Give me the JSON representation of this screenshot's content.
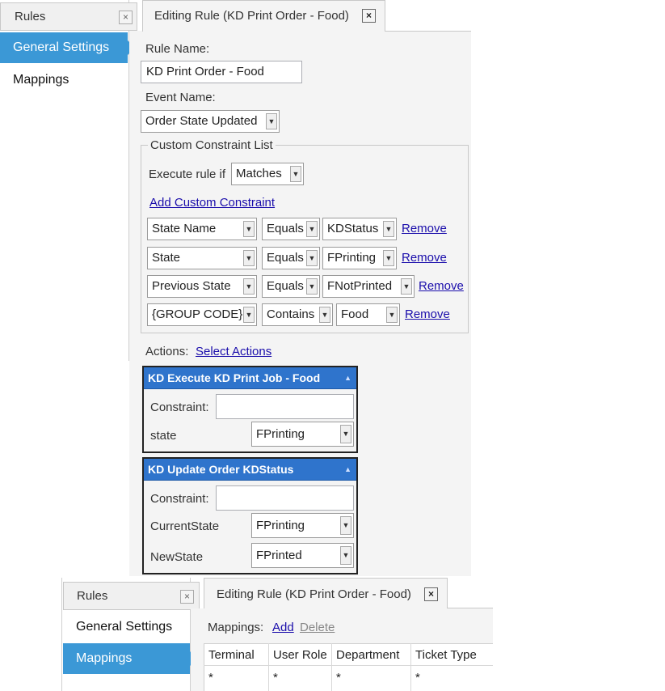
{
  "top": {
    "rules_tab": "Rules",
    "rules_close": "×",
    "editing_tab": "Editing Rule (KD Print Order - Food)",
    "editing_close": "×",
    "nav": {
      "general": "General Settings",
      "mappings": "Mappings"
    },
    "rule_name_label": "Rule Name:",
    "rule_name_value": "KD Print Order - Food",
    "event_name_label": "Event Name:",
    "event_name_value": "Order State Updated",
    "constraints": {
      "legend": "Custom Constraint List",
      "execute_label": "Execute rule if",
      "execute_value": "Matches",
      "add_link": "Add Custom Constraint",
      "remove_label": "Remove",
      "rows": [
        {
          "field": "State Name",
          "op": "Equals",
          "value": "KDStatus"
        },
        {
          "field": "State",
          "op": "Equals",
          "value": "FPrinting"
        },
        {
          "field": "Previous State",
          "op": "Equals",
          "value": "FNotPrinted"
        },
        {
          "field": "{GROUP CODE}",
          "op": "Contains",
          "value": "Food"
        }
      ]
    },
    "actions_label": "Actions:",
    "select_actions": "Select Actions",
    "actions": [
      {
        "title": "KD Execute KD Print Job - Food",
        "constraint_label": "Constraint:",
        "constraint_value": "",
        "param1_label": "state",
        "param1_value": "FPrinting"
      },
      {
        "title": "KD Update Order KDStatus",
        "constraint_label": "Constraint:",
        "constraint_value": "",
        "param1_label": "CurrentState",
        "param1_value": "FPrinting",
        "param2_label": "NewState",
        "param2_value": "FPrinted"
      }
    ]
  },
  "bottom": {
    "rules_tab": "Rules",
    "rules_close": "×",
    "editing_tab": "Editing Rule (KD Print Order - Food)",
    "editing_close": "×",
    "nav": {
      "general": "General Settings",
      "mappings": "Mappings"
    },
    "mappings_label": "Mappings:",
    "add_link": "Add",
    "delete_link": "Delete",
    "columns": [
      "Terminal",
      "User Role",
      "Department",
      "Ticket Type"
    ],
    "row": [
      "*",
      "*",
      "*",
      "*"
    ]
  },
  "colors": {
    "accent": "#3b98d6",
    "action_header": "#2f74cc",
    "link": "#1a0dab"
  }
}
